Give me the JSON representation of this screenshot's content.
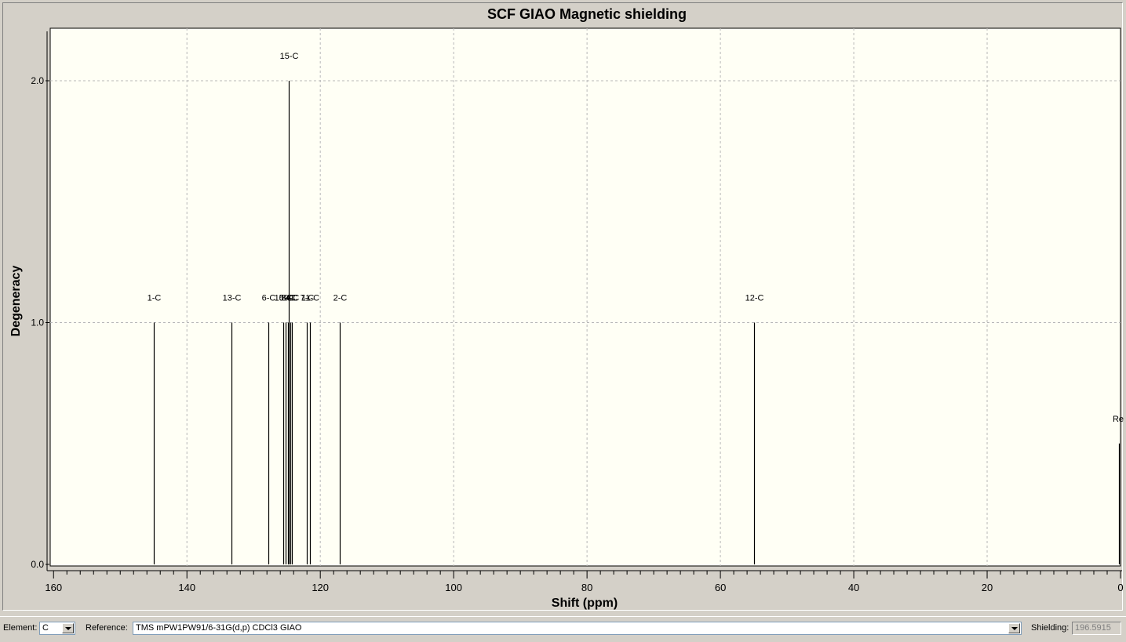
{
  "chart_data": {
    "type": "bar",
    "title": "SCF GIAO Magnetic shielding",
    "xlabel": "Shift (ppm)",
    "ylabel": "Degeneracy",
    "xlim": [
      160.5,
      0
    ],
    "ylim": [
      0,
      2.2
    ],
    "xticks": [
      "160",
      "140",
      "120",
      "100",
      "80",
      "60",
      "40",
      "20",
      "0"
    ],
    "yticks": [
      "0.0",
      "1.0",
      "2.0"
    ],
    "grid": true,
    "peaks": [
      {
        "label": "1-C",
        "x": 145.0,
        "y": 1
      },
      {
        "label": "13-C",
        "x": 133.3,
        "y": 1
      },
      {
        "label": "6-C",
        "x": 127.8,
        "y": 1
      },
      {
        "label": "10-C",
        "x": 125.5,
        "y": 1
      },
      {
        "label": "5-C",
        "x": 125.2,
        "y": 1
      },
      {
        "label": "8-C",
        "x": 124.9,
        "y": 1
      },
      {
        "label": "15-C",
        "x": 124.7,
        "y": 2
      },
      {
        "label": "9-C",
        "x": 124.5,
        "y": 1
      },
      {
        "label": "4-C",
        "x": 124.2,
        "y": 1
      },
      {
        "label": "7-C",
        "x": 122.0,
        "y": 1
      },
      {
        "label": "11-C",
        "x": 121.5,
        "y": 1
      },
      {
        "label": "2-C",
        "x": 117.1,
        "y": 1
      },
      {
        "label": "12-C",
        "x": 55.0,
        "y": 1
      },
      {
        "label": "Ref",
        "x": 0.2,
        "y": 0.5
      }
    ],
    "colors": {
      "plot_bg": "#fffff5",
      "frame_bg": "#d4d0c8",
      "line": "#000000",
      "grid": "#b8b8b8"
    }
  },
  "toolbar": {
    "element_label": "Element:",
    "element_value": "C",
    "reference_label": "Reference:",
    "reference_value": "TMS mPW1PW91/6-31G(d,p) CDCl3 GIAO",
    "shielding_label": "Shielding:",
    "shielding_value": "196.5915"
  }
}
